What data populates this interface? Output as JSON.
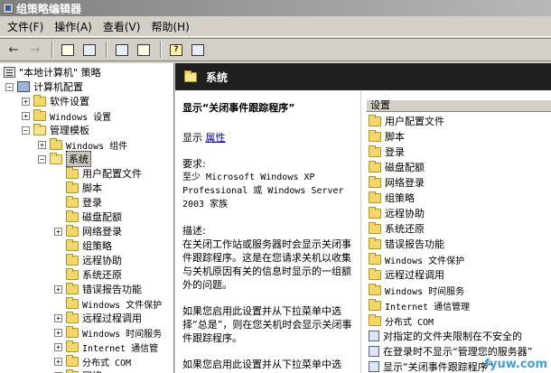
{
  "window": {
    "title": "组策略编辑器"
  },
  "menu": [
    "文件(F)",
    "操作(A)",
    "查看(V)",
    "帮助(H)"
  ],
  "toolbar": {
    "back": "←",
    "forward": "→"
  },
  "tree": {
    "root": "\"本地计算机\" 策略",
    "computer_config": "计算机配置",
    "software_settings": "软件设置",
    "windows_settings": "Windows 设置",
    "admin_templates": "管理模板",
    "windows_components": "Windows 组件",
    "system": "系统",
    "children": [
      "用户配置文件",
      "脚本",
      "登录",
      "磁盘配额",
      "网络登录",
      "组策略",
      "远程协助",
      "系统还原",
      "错误报告功能",
      "Windows 文件保护",
      "远程过程调用",
      "Windows 时间服务",
      "Internet 通信管",
      "分布式 COM",
      "网络"
    ]
  },
  "header": {
    "title": "系统"
  },
  "description": {
    "title": "显示“关闭事件跟踪程序”",
    "display_label": "显示",
    "properties_link": "属性",
    "requirements_label": "要求:",
    "requirements_text": "至少 Microsoft Windows XP Professional 或 Windows Server 2003 家族",
    "desc_label": "描述:",
    "desc_p1": "在关闭工作站或服务器时会显示关闭事件跟踪程序。这是在您请求关机以收集与关机原因有关的信息时显示的一组额外的问题。",
    "desc_p2": "如果您启用此设置并从下拉菜单中选择“总是”，则在您关机时会显示关闭事件跟踪程序。",
    "desc_p3": "如果您启用此设置并从下拉菜单中选择“仅服务器”，则在您关闭"
  },
  "list": {
    "column_header": "设置",
    "folders": [
      "用户配置文件",
      "脚本",
      "登录",
      "磁盘配额",
      "网络登录",
      "组策略",
      "远程协助",
      "系统还原",
      "错误报告功能",
      "Windows 文件保护",
      "远程过程调用",
      "Windows 时间服务",
      "Internet 通信管理",
      "分布式 COM"
    ],
    "settings": [
      "对指定的文件夹限制在不安全的",
      "在登录时不显示“管理您的服务器”",
      "显示“关闭事件跟踪程序”"
    ]
  },
  "watermark": "fyuw.com"
}
